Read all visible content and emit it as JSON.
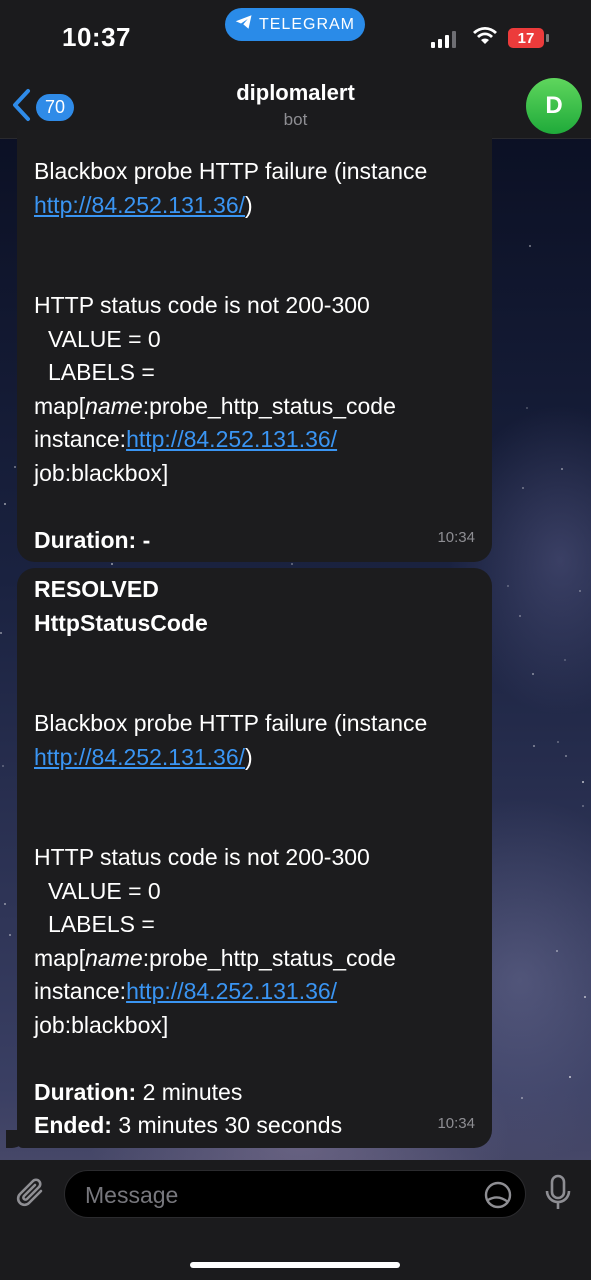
{
  "status_bar": {
    "time": "10:37",
    "app_pill": "TELEGRAM",
    "battery": "17"
  },
  "header": {
    "back_count": "70",
    "title": "diplomalert",
    "subtitle": "bot",
    "avatar_letter": "D"
  },
  "messages": [
    {
      "alert_text": "Blackbox probe HTTP failure (instance",
      "link": "http://84.252.131.36/",
      "link_suffix": ")",
      "status_line": "HTTP status code is not 200-300",
      "value_line": "VALUE = 0",
      "labels_line": "LABELS =",
      "map_prefix": "map[",
      "map_name": "name",
      "map_rest": ":probe_http_status_code",
      "instance_prefix": "instance:",
      "instance_link": "http://84.252.131.36/",
      "job_line": "job:blackbox]",
      "duration_label": "Duration:",
      "duration_value": "-",
      "time": "10:34"
    },
    {
      "resolved": "RESOLVED",
      "alert_name": "HttpStatusCode",
      "alert_text": "Blackbox probe HTTP failure (instance",
      "link": "http://84.252.131.36/",
      "link_suffix": ")",
      "status_line": "HTTP status code is not 200-300",
      "value_line": "VALUE = 0",
      "labels_line": "LABELS =",
      "map_prefix": "map[",
      "map_name": "name",
      "map_rest": ":probe_http_status_code",
      "instance_prefix": "instance:",
      "instance_link": "http://84.252.131.36/",
      "job_line": "job:blackbox]",
      "duration_label": "Duration:",
      "duration_value": "2 minutes",
      "ended_label": "Ended:",
      "ended_value": "3 minutes 30 seconds",
      "time": "10:34"
    }
  ],
  "input": {
    "placeholder": "Message"
  },
  "colors": {
    "accent": "#2f8be8",
    "link": "#3a95f3",
    "bubble": "#1c1c1e",
    "bar": "#1b1b1d",
    "battery_low": "#ec3b3b",
    "avatar_green": "#1faa3a"
  },
  "icons": [
    "telegram-icon",
    "signal-icon",
    "wifi-icon",
    "battery-icon",
    "chevron-left-icon",
    "paperclip-icon",
    "sticker-icon",
    "microphone-icon"
  ]
}
